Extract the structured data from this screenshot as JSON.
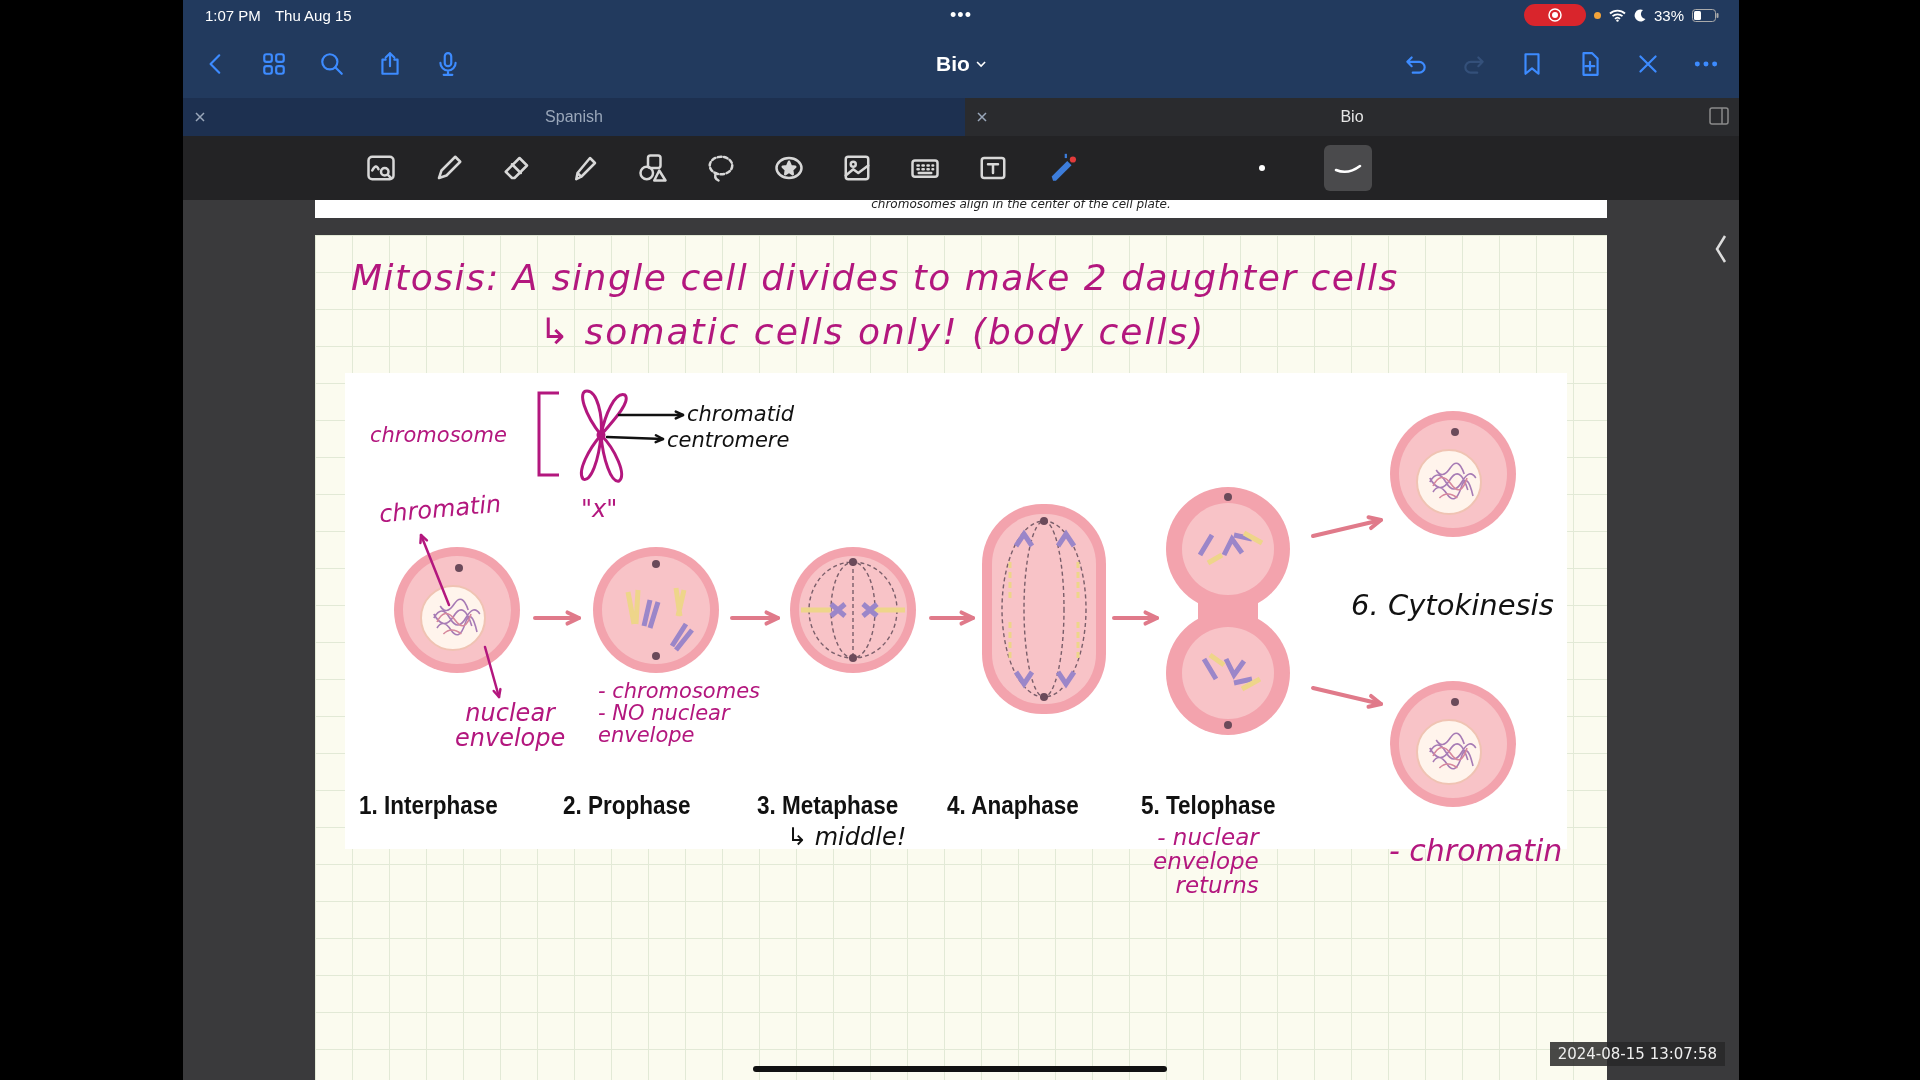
{
  "status_bar": {
    "time": "1:07 PM",
    "date": "Thu Aug 15",
    "dots": "•••",
    "battery": "33%"
  },
  "nav_bar": {
    "title": "Bio"
  },
  "tabs": [
    {
      "label": "Spanish",
      "selected": false
    },
    {
      "label": "Bio",
      "selected": true
    }
  ],
  "pen_sizes": [
    {
      "selected": false
    },
    {
      "selected": true
    }
  ],
  "previous_page": {
    "caption": "chromosomes align in the center of the cell plate."
  },
  "note": {
    "title": "Mitosis: A single cell divides to make 2 daughter cells",
    "subtitle": "↳ somatic cells only! (body cells)"
  },
  "diagram": {
    "chromosome": "chromosome",
    "chromatid": "chromatid",
    "centromere": "centromere",
    "x_label": "\"x\"",
    "chromatin": "chromatin",
    "nuclear_envelope": [
      "nuclear",
      "envelope"
    ],
    "phases": [
      {
        "label": "1. Interphase",
        "kind": "interphase"
      },
      {
        "label": "2. Prophase",
        "kind": "prophase"
      },
      {
        "label": "3. Metaphase",
        "kind": "metaphase"
      },
      {
        "label": "4. Anaphase",
        "kind": "anaphase"
      },
      {
        "label": "5. Telophase",
        "kind": "telophase"
      }
    ],
    "prophase_notes": [
      "- chromosomes",
      "- NO nuclear",
      "envelope"
    ],
    "metaphase_note": "↳ middle!",
    "telophase_notes": [
      "- nuclear",
      "envelope",
      "returns"
    ],
    "cytokinesis": "6. Cytokinesis",
    "cytokinesis_note": "- chromatin"
  },
  "timestamp": "2024-08-15 13:07:58"
}
